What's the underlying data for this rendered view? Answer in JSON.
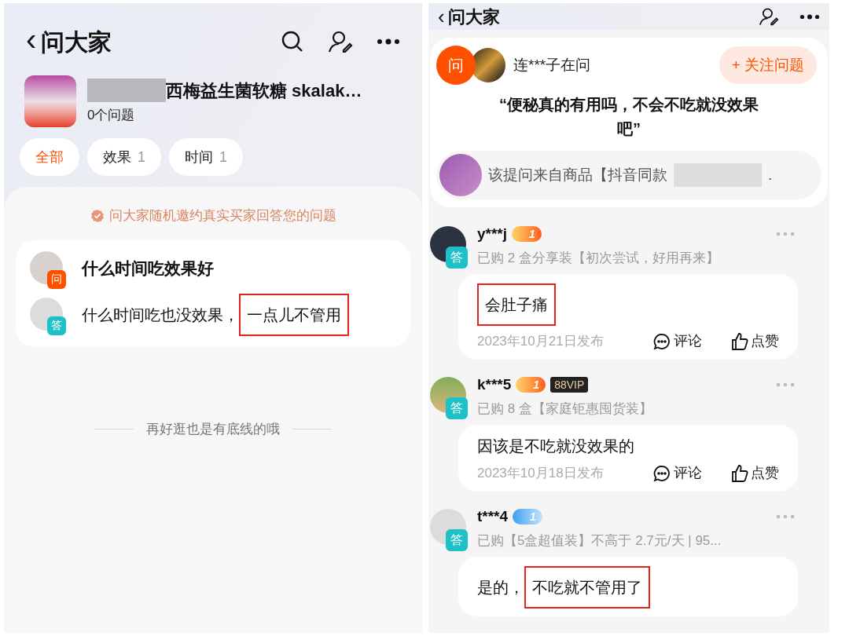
{
  "left": {
    "header": {
      "back": "‹",
      "title": "问大家"
    },
    "product": {
      "title": "西梅益生菌软糖 skalak…",
      "count": "0个问题"
    },
    "chips": [
      {
        "label": "全部",
        "selected": true
      },
      {
        "label": "效果",
        "count": "1",
        "selected": false
      },
      {
        "label": "时间",
        "count": "1",
        "selected": false
      }
    ],
    "notice": "问大家随机邀约真实买家回答您的问题",
    "qa": {
      "question_badge": "问",
      "question": "什么时间吃效果好",
      "answer_badge": "答",
      "answer": [
        {
          "text": "什么时间吃也没效果，",
          "highlighted": false
        },
        {
          "text": "一点儿不管用",
          "highlighted": true
        }
      ]
    },
    "footer": "再好逛也是有底线的哦"
  },
  "right": {
    "header": {
      "back": "‹",
      "title": "问大家"
    },
    "question": {
      "badge": "问",
      "asker": "连***子在问",
      "follow_button": "+ 关注问题",
      "text": "“便秘真的有用吗，不会不吃就没效果吧”",
      "source": "该提问来自商品【抖音同款",
      "source_tail": "."
    },
    "answers": [
      {
        "badge": "答",
        "name": "y***j",
        "level": {
          "kind": "crown",
          "text": "1"
        },
        "purchase": "已购 2 盒分享装【初次尝试，好用再来】",
        "body": [
          {
            "text": "会肚子痛",
            "highlighted": true
          }
        ],
        "date": "2023年10月21日发布",
        "comment": "评论",
        "like": "点赞"
      },
      {
        "badge": "答",
        "name": "k***5",
        "level": {
          "kind": "crown",
          "text": "1"
        },
        "vip": "88VIP",
        "purchase": "已购 8 盒【家庭钜惠囤货装】",
        "body": [
          {
            "text": "因该是不吃就没效果的",
            "highlighted": false
          }
        ],
        "date": "2023年10月18日发布",
        "comment": "评论",
        "like": "点赞"
      },
      {
        "badge": "答",
        "name": "t***4",
        "level": {
          "kind": "diamond",
          "text": "1"
        },
        "purchase": "已购【5盒超值装】不高于 2.7元/天 | 95...",
        "body": [
          {
            "text": "是的，",
            "highlighted": false
          },
          {
            "text": "不吃就不管用了",
            "highlighted": true
          }
        ]
      }
    ]
  }
}
